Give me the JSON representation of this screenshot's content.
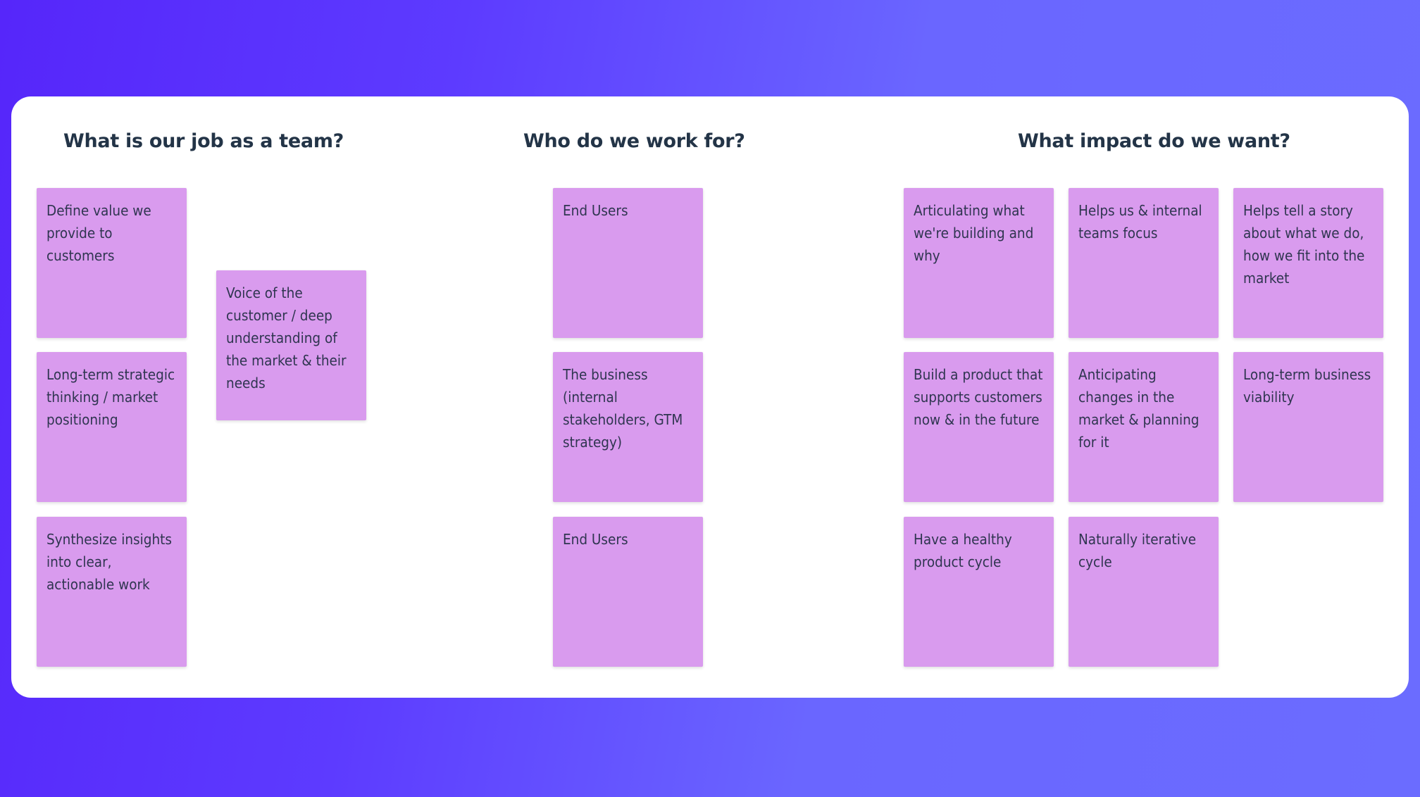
{
  "colors": {
    "background_start": "#5626fa",
    "background_end": "#6b6cff",
    "board": "#ffffff",
    "sticky": "#d99bee",
    "heading_text": "#233447",
    "sticky_text": "#2f3550"
  },
  "sections": [
    {
      "title": "What is our job as a team?",
      "stickies": [
        "Define value we provide to customers",
        "Long-term strategic thinking / market positioning",
        "Synthesize insights into clear, actionable work",
        "Voice of the customer / deep understanding of the market & their needs"
      ]
    },
    {
      "title": "Who do we work for?",
      "stickies": [
        "End Users",
        "The business (internal stakeholders, GTM strategy)",
        "End Users"
      ]
    },
    {
      "title": "What impact do we want?",
      "stickies": [
        "Articulating what we're building and why",
        "Helps us & internal teams focus",
        "Helps tell a story about what we do, how we fit into the market",
        "Build a product that supports customers now & in the future",
        "Anticipating changes in the market & planning for it",
        "Long-term business viability",
        "Have a healthy product cycle",
        "Naturally iterative cycle"
      ]
    }
  ]
}
